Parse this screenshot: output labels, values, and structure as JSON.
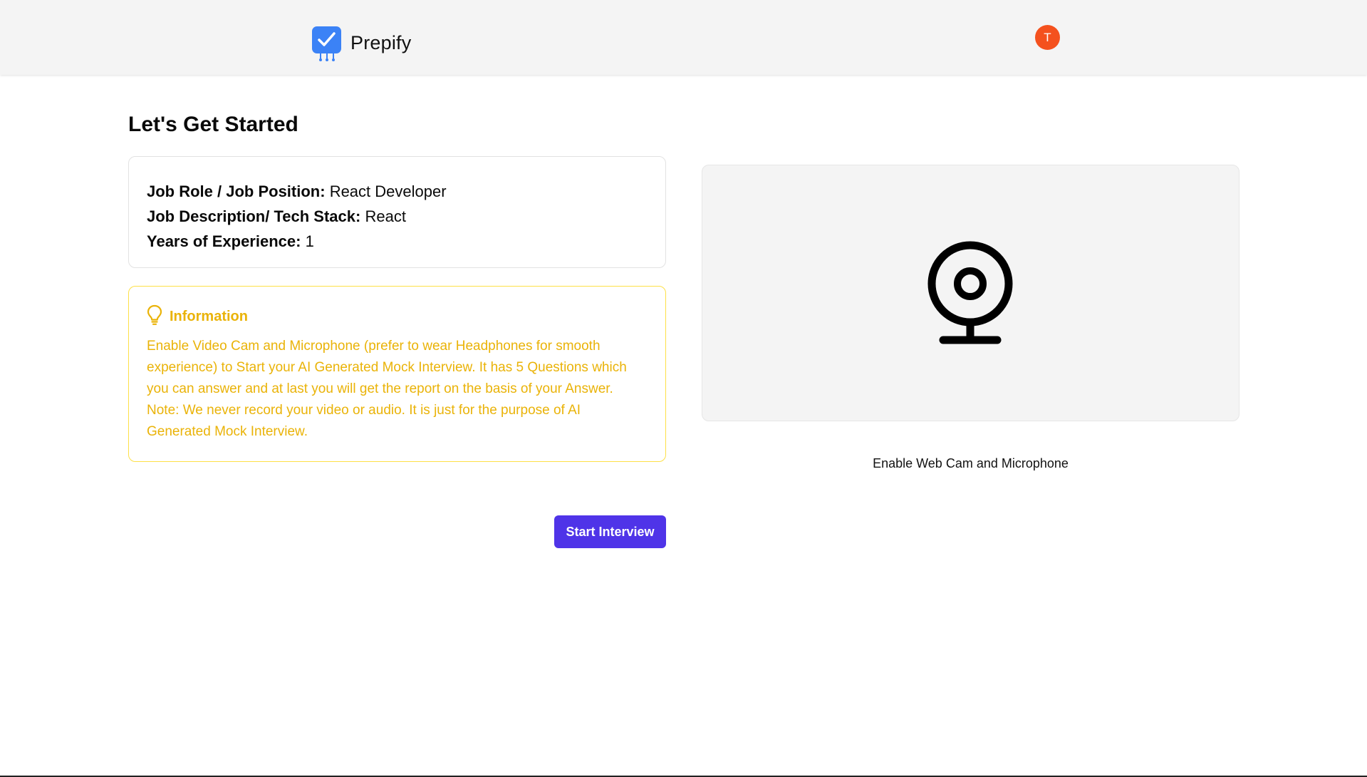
{
  "header": {
    "brand_name": "Prepify",
    "brand_color": "#3b82f6",
    "avatar_initial": "T",
    "avatar_color": "#f4511e"
  },
  "main": {
    "title": "Let's Get Started",
    "job": {
      "role_label": "Job Role / Job Position:",
      "role_value": "React Developer",
      "desc_label": "Job Description/ Tech Stack:",
      "desc_value": "React",
      "exp_label": "Years of Experience:",
      "exp_value": "1"
    },
    "info": {
      "icon": "lightbulb-icon",
      "title": "Information",
      "text": "Enable Video Cam and Microphone (prefer to wear Headphones for smooth experience) to Start your AI Generated Mock Interview. It has 5 Questions which you can answer and at last you will get the report on the basis of your Answer. Note: We never record your video or audio. It is just for the purpose of AI Generated Mock Interview.",
      "accent_color": "#eab308"
    },
    "webcam": {
      "icon": "webcam-icon",
      "enable_label": "Enable Web Cam and Microphone"
    },
    "start_button_label": "Start Interview",
    "start_button_color": "#4f34e8"
  }
}
